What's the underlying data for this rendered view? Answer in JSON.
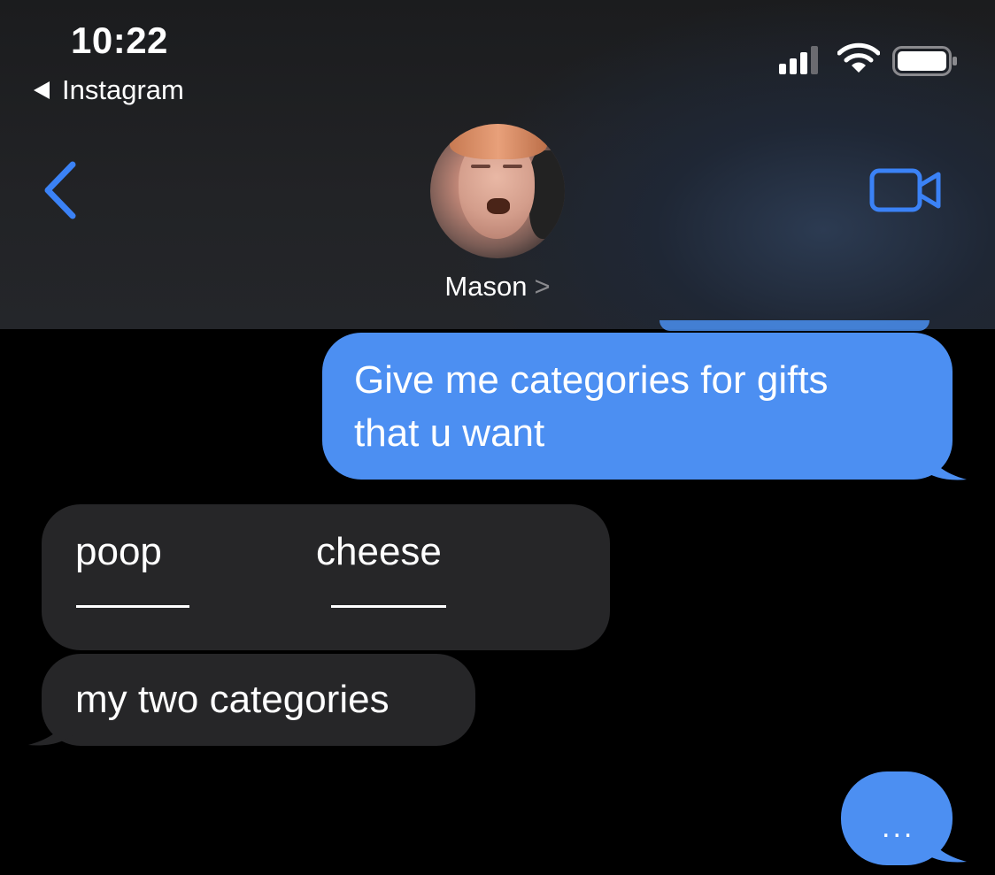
{
  "status_bar": {
    "time": "10:22",
    "back_app_label": "Instagram"
  },
  "header": {
    "contact_name": "Mason",
    "contact_chevron": ">"
  },
  "messages": [
    {
      "side": "sent",
      "text_line1": "Give me categories for gifts",
      "text_line2": "that u want"
    },
    {
      "side": "received",
      "word1": "poop",
      "word2": "cheese"
    },
    {
      "side": "received",
      "text": "my two categories"
    },
    {
      "side": "sent",
      "text": "..."
    }
  ],
  "colors": {
    "sent_bubble": "#4c8ff2",
    "received_bubble": "#262628",
    "accent_blue": "#3b82f6"
  },
  "icons": {
    "back": "chevron-left-icon",
    "video": "video-camera-icon",
    "signal": "cellular-signal-icon",
    "wifi": "wifi-icon",
    "battery": "battery-icon"
  }
}
